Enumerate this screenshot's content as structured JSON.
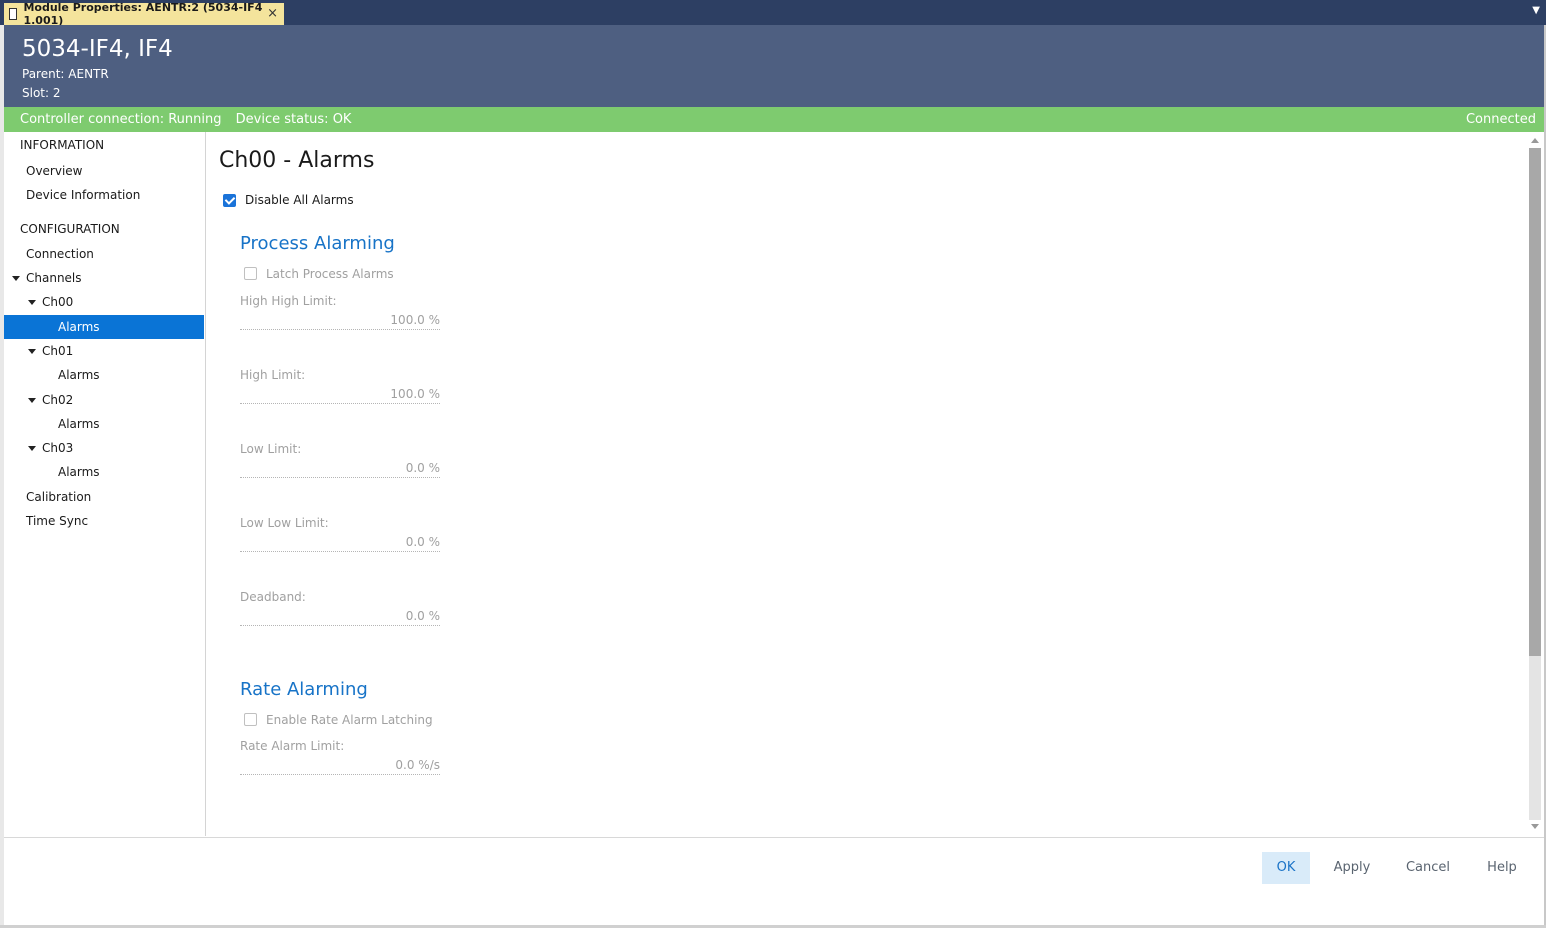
{
  "tab": {
    "title": "Module Properties:  AENTR:2 (5034-IF4 1.001)",
    "close": "×",
    "dropdown": "▼"
  },
  "header": {
    "title": "5034-IF4, IF4",
    "parent": "Parent:  AENTR",
    "slot": "Slot:  2"
  },
  "status": {
    "controller": "Controller connection: Running",
    "device": "Device status: OK",
    "connected": "Connected"
  },
  "nav": {
    "information": "INFORMATION",
    "overview": "Overview",
    "device_information": "Device Information",
    "configuration": "CONFIGURATION",
    "connection": "Connection",
    "channels": "Channels",
    "ch00": "Ch00",
    "ch00_alarms": "Alarms",
    "ch01": "Ch01",
    "ch01_alarms": "Alarms",
    "ch02": "Ch02",
    "ch02_alarms": "Alarms",
    "ch03": "Ch03",
    "ch03_alarms": "Alarms",
    "calibration": "Calibration",
    "time_sync": "Time Sync"
  },
  "content": {
    "title": "Ch00  - Alarms",
    "disable_all": {
      "label": "Disable All Alarms",
      "checked": true
    },
    "process": {
      "title": "Process Alarming",
      "latch": {
        "label": "Latch Process Alarms",
        "checked": false
      },
      "high_high": {
        "label": "High High Limit:",
        "value": "100.0 %"
      },
      "high": {
        "label": "High Limit:",
        "value": "100.0 %"
      },
      "low": {
        "label": "Low Limit:",
        "value": "0.0 %"
      },
      "low_low": {
        "label": "Low Low Limit:",
        "value": "0.0 %"
      },
      "deadband": {
        "label": "Deadband:",
        "value": "0.0 %"
      }
    },
    "rate": {
      "title": "Rate Alarming",
      "latching": {
        "label": "Enable Rate Alarm Latching",
        "checked": false
      },
      "limit": {
        "label": "Rate Alarm Limit:",
        "value": "0.0 %/s"
      }
    }
  },
  "footer": {
    "ok": "OK",
    "apply": "Apply",
    "cancel": "Cancel",
    "help": "Help"
  }
}
